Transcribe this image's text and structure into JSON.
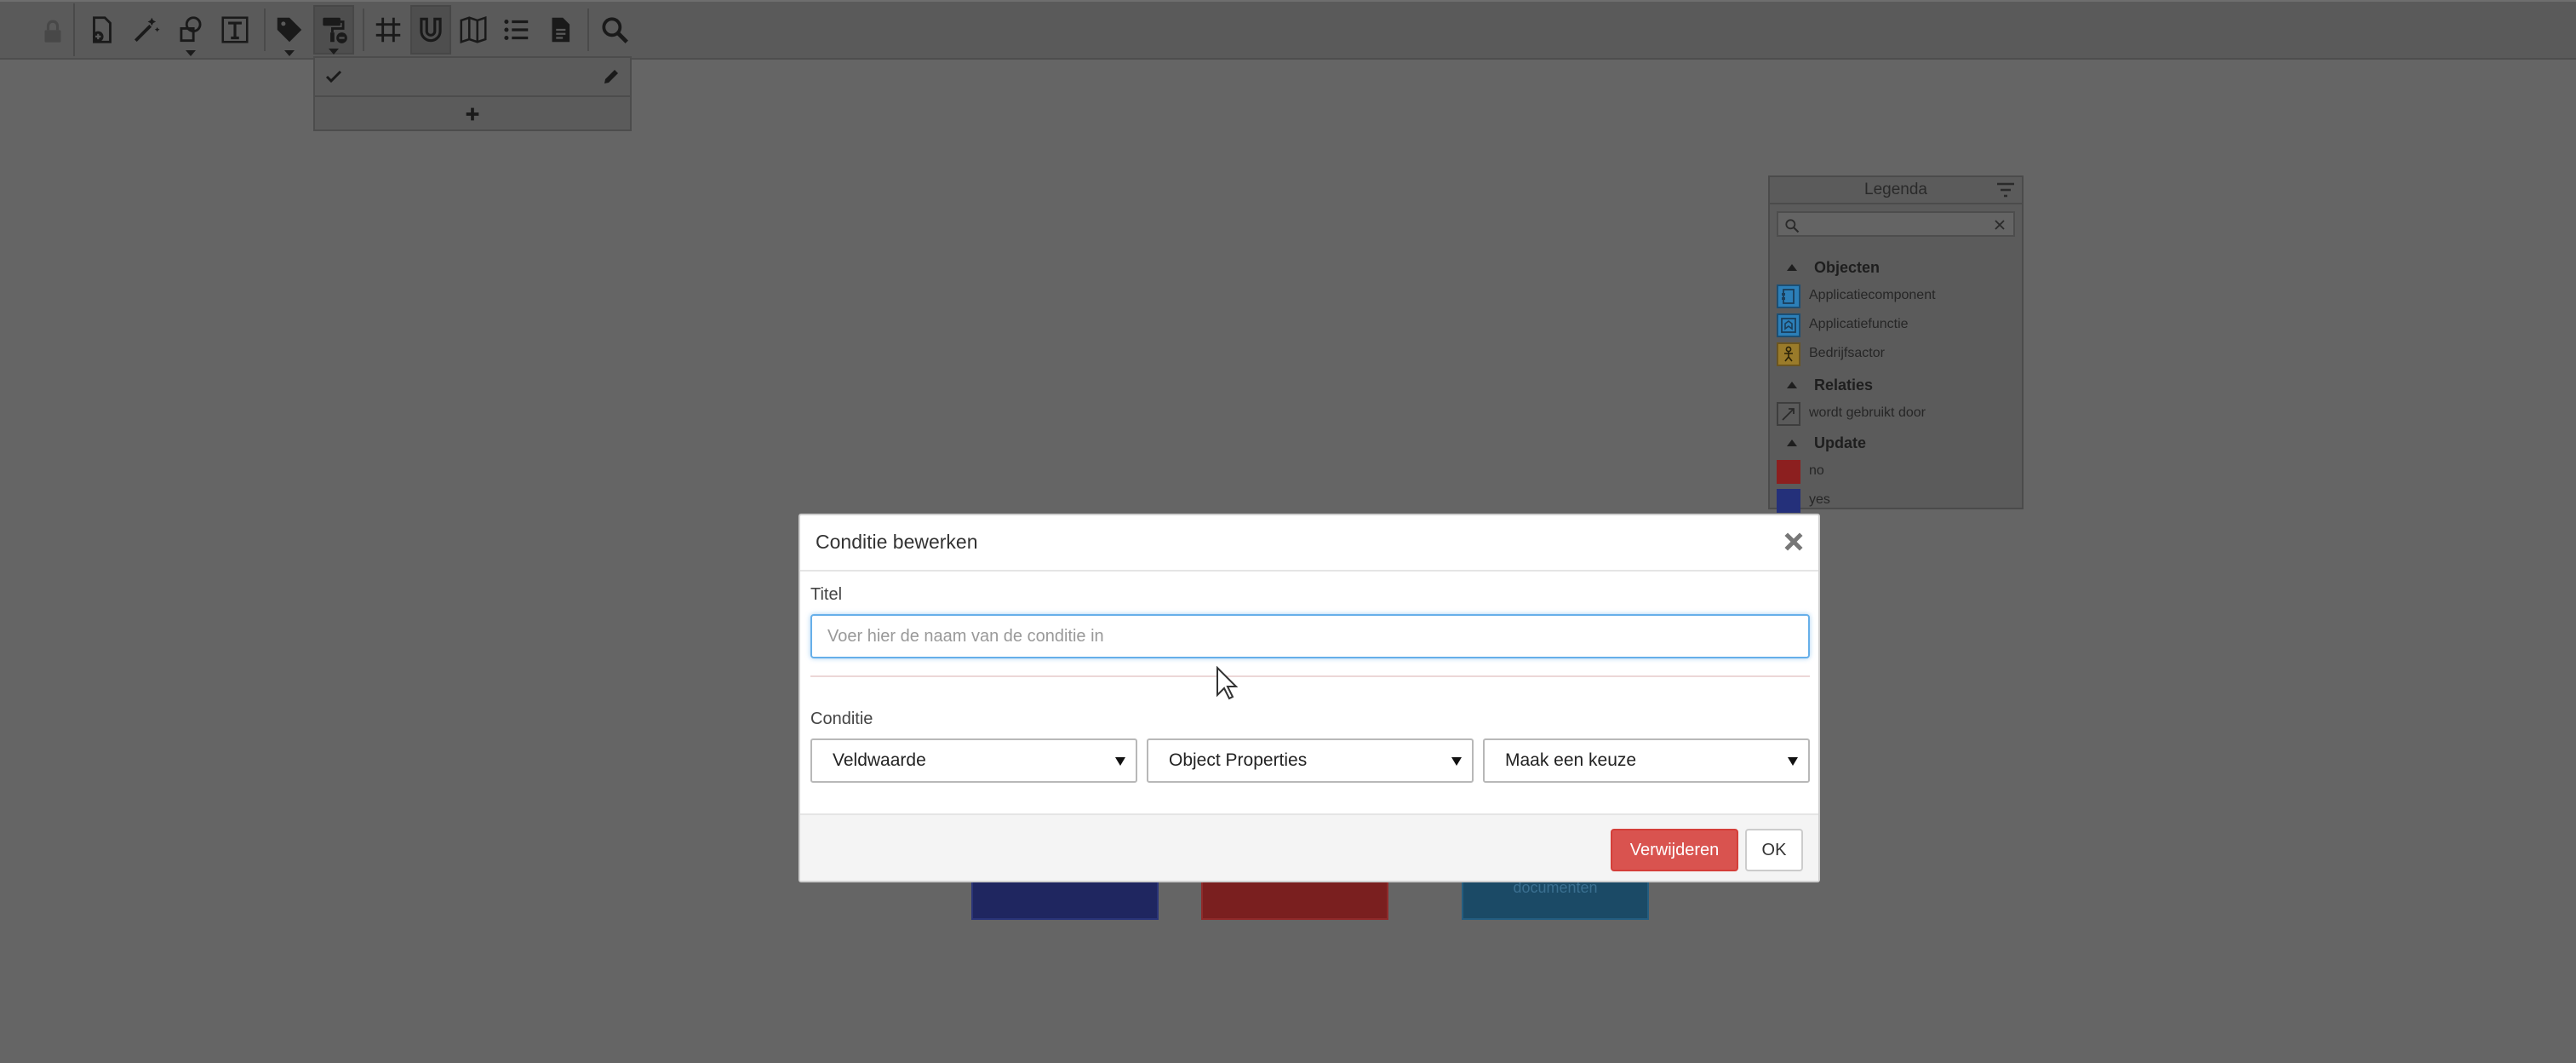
{
  "toolbar": {
    "icons": [
      "lock-icon",
      "new-document-icon",
      "magic-wand-icon",
      "shapes-icon",
      "text-box-icon",
      "tag-icon",
      "paint-format-icon",
      "grid-icon",
      "magnet-icon",
      "map-icon",
      "list-icon",
      "document-icon",
      "search-icon"
    ],
    "active": "paint-format-icon"
  },
  "legend": {
    "title": "Legenda",
    "search_value": "",
    "groups": [
      {
        "label": "Objecten",
        "items": [
          {
            "label": "Applicatiecomponent",
            "color": "#2c7fb8"
          },
          {
            "label": "Applicatiefunctie",
            "color": "#2c7fb8"
          },
          {
            "label": "Bedrijfsactor",
            "color": "#b8932c"
          }
        ]
      },
      {
        "label": "Relaties",
        "items": [
          {
            "label": "wordt gebruikt door",
            "color": "#5b5b5b"
          }
        ]
      },
      {
        "label": "Update",
        "items": [
          {
            "label": "no",
            "color": "#8c1f1f"
          },
          {
            "label": "yes",
            "color": "#24307a"
          }
        ]
      }
    ]
  },
  "background_boxes": [
    {
      "label": "",
      "color": "#1f2660"
    },
    {
      "label": "",
      "color": "#7a1f1f"
    },
    {
      "label": "documenten",
      "color": "#1b4a66"
    }
  ],
  "modal": {
    "title": "Conditie bewerken",
    "title_field_label": "Titel",
    "title_field_value": "",
    "title_field_placeholder": "Voer hier de naam van de conditie in",
    "condition_label": "Conditie",
    "select_1": "Veldwaarde",
    "select_2": "Object Properties",
    "select_3": "Maak een keuze",
    "delete_label": "Verwijderen",
    "ok_label": "OK"
  },
  "colors": {
    "overlay": "#656565",
    "focus_border": "#66afe9",
    "danger": "#d9534f"
  }
}
